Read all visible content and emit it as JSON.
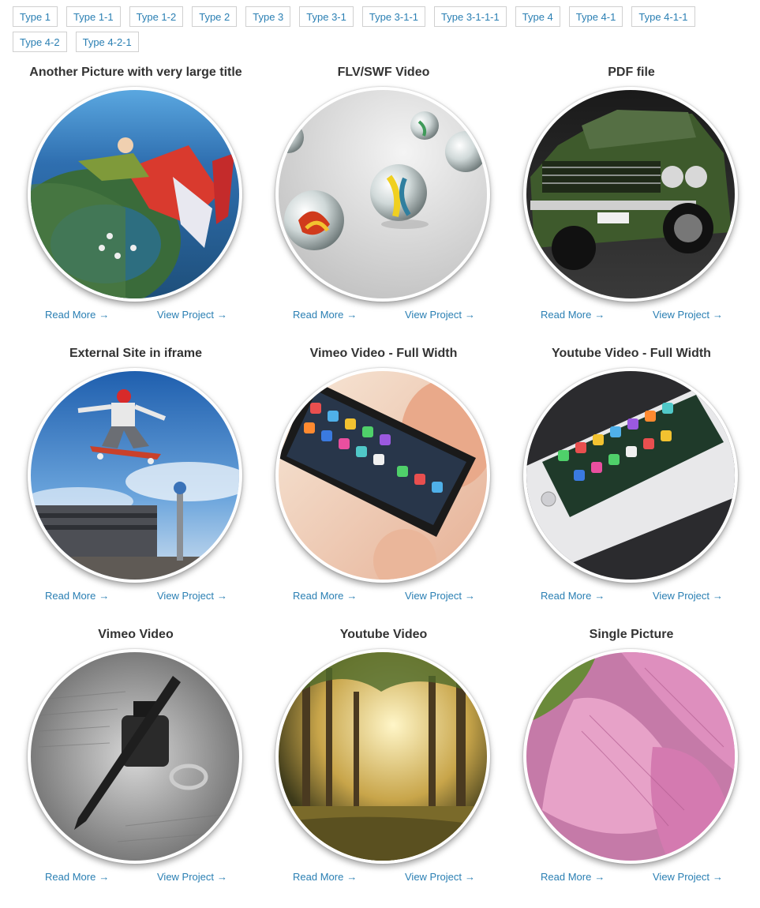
{
  "filters": [
    "Type 1",
    "Type 1-1",
    "Type 1-2",
    "Type 2",
    "Type 3",
    "Type 3-1",
    "Type 3-1-1",
    "Type 3-1-1-1",
    "Type 4",
    "Type 4-1",
    "Type 4-1-1",
    "Type 4-2",
    "Type 4-2-1"
  ],
  "arrow": "→",
  "items": [
    {
      "title": "Another Picture with very large title",
      "read_more": "Read More",
      "view_project": "View Project",
      "image": "skydivers-image"
    },
    {
      "title": "FLV/SWF Video",
      "read_more": "Read More",
      "view_project": "View Project",
      "image": "marbles-image"
    },
    {
      "title": "PDF file",
      "read_more": "Read More",
      "view_project": "View Project",
      "image": "mustang-car-image"
    },
    {
      "title": "External Site in iframe",
      "read_more": "Read More",
      "view_project": "View Project",
      "image": "skateboarder-image"
    },
    {
      "title": "Vimeo Video - Full Width",
      "read_more": "Read More",
      "view_project": "View Project",
      "image": "iphone-in-hand-image"
    },
    {
      "title": "Youtube Video - Full Width",
      "read_more": "Read More",
      "view_project": "View Project",
      "image": "iphone-on-dark-image"
    },
    {
      "title": "Vimeo Video",
      "read_more": "Read More",
      "view_project": "View Project",
      "image": "ink-bottle-image"
    },
    {
      "title": "Youtube Video",
      "read_more": "Read More",
      "view_project": "View Project",
      "image": "forest-image"
    },
    {
      "title": "Single Picture",
      "read_more": "Read More",
      "view_project": "View Project",
      "image": "pink-flower-image"
    }
  ],
  "colors": {
    "link": "#2a7fb3",
    "title": "#333333",
    "filter_border": "#d0d0d0"
  }
}
